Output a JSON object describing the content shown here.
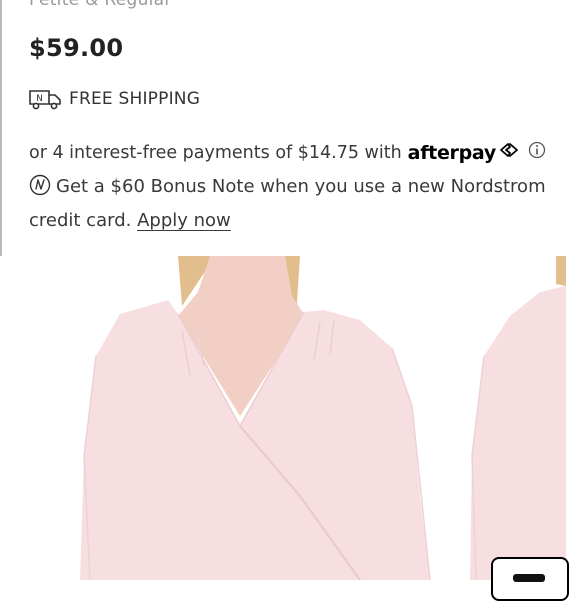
{
  "product": {
    "fit_options": "Petite & Regular",
    "price": "$59.00"
  },
  "shipping": {
    "icon": "delivery-truck-icon",
    "truck_letter": "N",
    "label": "FREE SHIPPING"
  },
  "afterpay": {
    "text": "or 4 interest-free payments of $14.75 with",
    "brand": "afterpay",
    "icon": "afterpay-arrows-icon",
    "info_icon": "info-icon"
  },
  "bonus": {
    "icon": "nordstrom-note-icon",
    "text": "Get a $60 Bonus Note when you use a new Nordstrom credit card.",
    "link": "Apply now"
  },
  "gallery": {
    "images": [
      "blouse-front-photo",
      "blouse-side-photo"
    ],
    "colors": {
      "blouse": "#f7dfe1",
      "skin": "#f2cfc4",
      "hair": "#e3be8d"
    }
  }
}
